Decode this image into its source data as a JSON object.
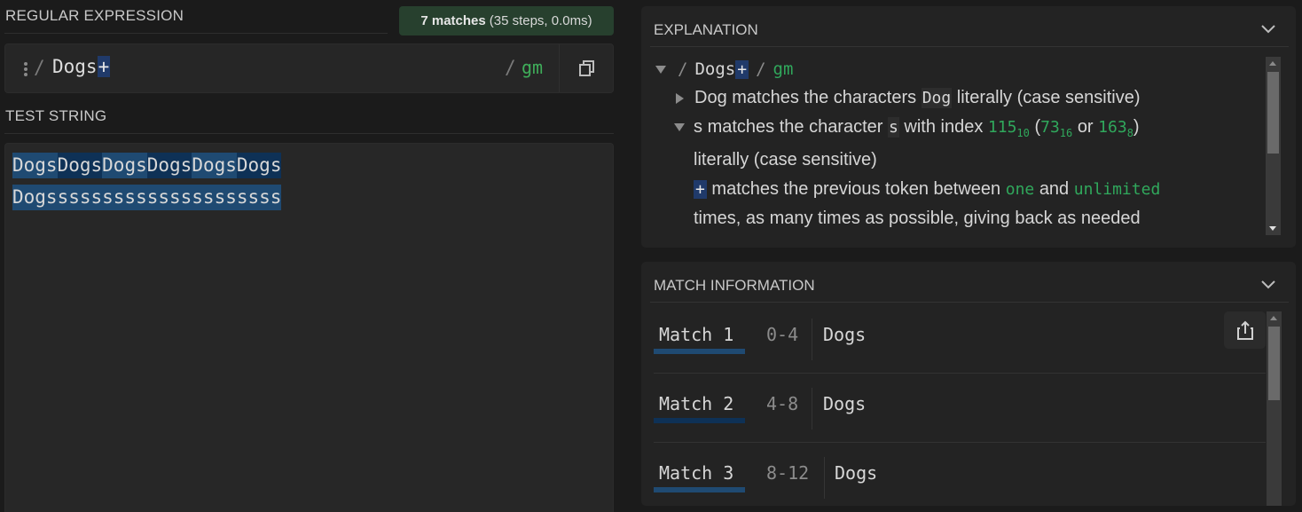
{
  "regex_section": {
    "title": "REGULAR EXPRESSION",
    "match_count": "7 matches",
    "match_stats": "(35 steps, 0.0ms)",
    "delimiter_open": "/",
    "pattern_prefix": "Dogs",
    "pattern_quantifier": "+",
    "delimiter_close": "/",
    "flags": "gm",
    "copy_icon": "copy-icon",
    "drag_icon": "drag-handle-icon"
  },
  "test_string_section": {
    "title": "TEST STRING",
    "line1_segments": [
      "Dogs",
      "Dogs",
      "Dogs",
      "Dogs",
      "Dogs",
      "Dogs"
    ],
    "line2": "Dogsssssssssssssssssssss"
  },
  "explanation": {
    "title": "EXPLANATION",
    "root": {
      "delim_open": "/",
      "pattern": "Dogs",
      "quantifier": "+",
      "delim_close": "/",
      "flags": "gm"
    },
    "item1": {
      "token": "Dog",
      "text_before": "matches the characters",
      "chip": "Dog",
      "text_after": "literally (case sensitive)"
    },
    "item2": {
      "token": "s",
      "text_before": "matches the character",
      "chip": "s",
      "text_mid": "with index",
      "dec": "115",
      "dec_base": "10",
      "paren_open": "(",
      "hex": "73",
      "hex_base": "16",
      "or": "or",
      "oct": "163",
      "oct_base": "8",
      "paren_close": ")",
      "line2": "literally (case sensitive)"
    },
    "item3": {
      "chip": "+",
      "text_before": "matches the previous token between",
      "min": "one",
      "and": "and",
      "max": "unlimited",
      "line2": "times, as many times as possible, giving back as needed"
    }
  },
  "match_information": {
    "title": "MATCH INFORMATION",
    "share_icon": "share-icon",
    "matches": [
      {
        "label": "Match 1",
        "range": "0-4",
        "value": "Dogs"
      },
      {
        "label": "Match 2",
        "range": "4-8",
        "value": "Dogs"
      },
      {
        "label": "Match 3",
        "range": "8-12",
        "value": "Dogs"
      }
    ]
  },
  "colors": {
    "badge_bg": "#27402e",
    "match_highlight_a": "#1f4a72",
    "match_highlight_b": "#0e3156",
    "flag_green": "#3fae5a",
    "quantifier_bg": "#203a6a"
  }
}
